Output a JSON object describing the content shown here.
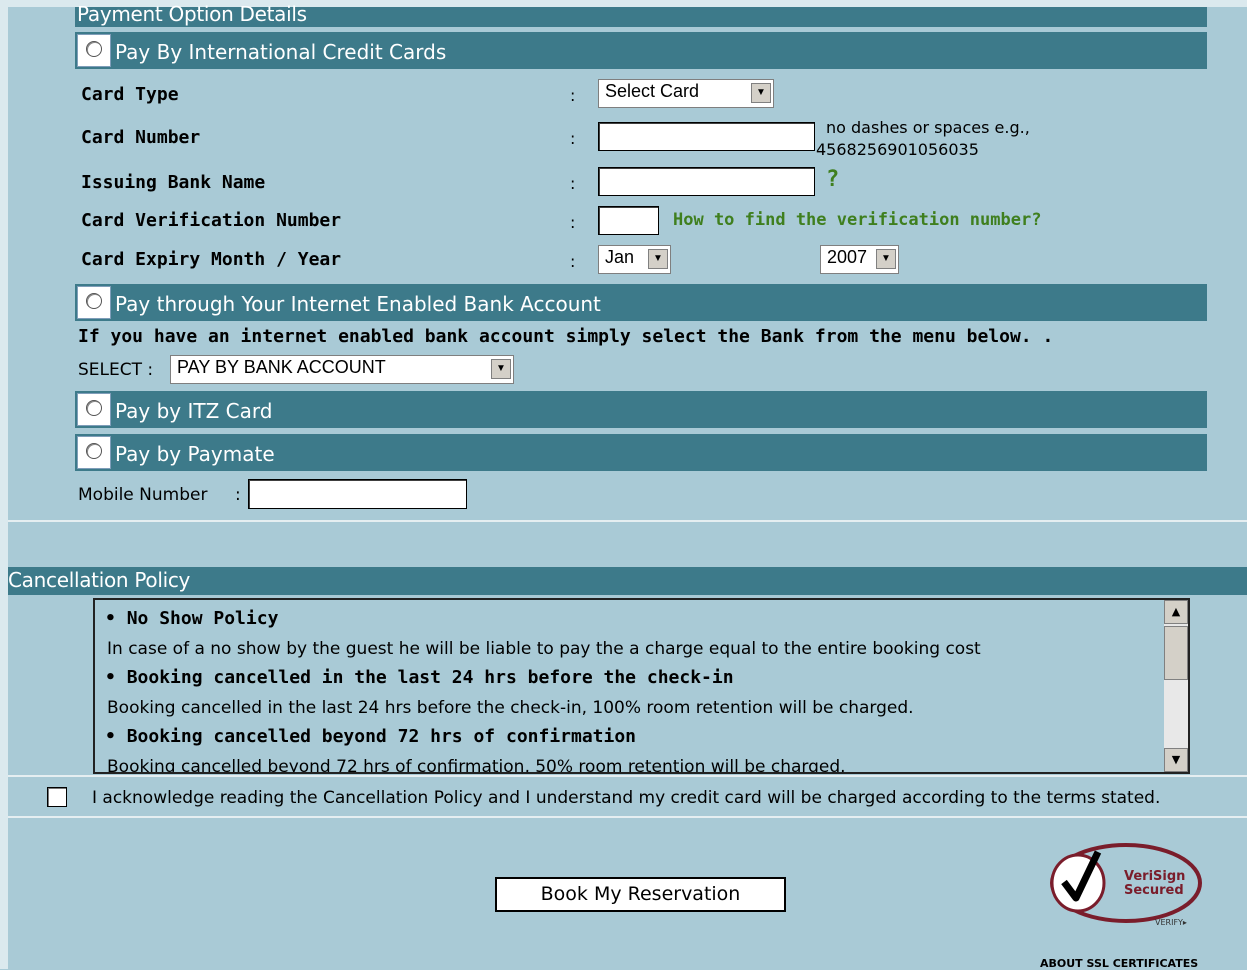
{
  "payment": {
    "header": "Payment Option Details",
    "options": {
      "credit_cards": "Pay By International Credit Cards",
      "bank_account": "Pay through Your Internet Enabled Bank Account",
      "itz": "Pay by ITZ Card",
      "paymate": "Pay by Paymate"
    },
    "fields": {
      "card_type": "Card Type",
      "card_number": "Card Number",
      "issuing_bank": "Issuing Bank Name",
      "cvn": "Card Verification Number",
      "expiry": "Card Expiry Month / Year"
    },
    "colon": ":",
    "card_type_value": "Select Card",
    "card_number_hint_line1": "no dashes or spaces e.g.,",
    "card_number_hint_line2": "4568256901056035",
    "bank_help": "?",
    "cvn_link": "How to find the verification number?",
    "expiry_month": "Jan",
    "expiry_year": "2007",
    "bank_instruction": "If you have an internet enabled bank account simply select the Bank from the menu below. .",
    "bank_select_label": "SELECT :",
    "bank_select_value": "PAY BY BANK ACCOUNT",
    "mobile_label": "Mobile Number",
    "mobile_colon": ":"
  },
  "cancellation": {
    "header": "Cancellation Policy",
    "items": [
      {
        "title": "No Show Policy",
        "text": "In case of a no show by the guest he will be liable to pay the a charge equal to the entire booking cost"
      },
      {
        "title": "Booking cancelled in the last 24 hrs before the check-in",
        "text": "Booking cancelled in the last 24 hrs before the check-in, 100% room retention will be charged."
      },
      {
        "title": "Booking cancelled beyond 72 hrs of confirmation",
        "text": "Booking cancelled beyond 72 hrs of confirmation, 50% room retention will be charged."
      }
    ],
    "acknowledge": "I acknowledge reading the Cancellation Policy and I understand my credit card will be charged according to the terms stated."
  },
  "actions": {
    "book": "Book My Reservation"
  },
  "seal": {
    "line1": "VeriSign",
    "line2": "Secured",
    "verify": "VERIFY▸",
    "about": "ABOUT SSL CERTIFICATES"
  }
}
